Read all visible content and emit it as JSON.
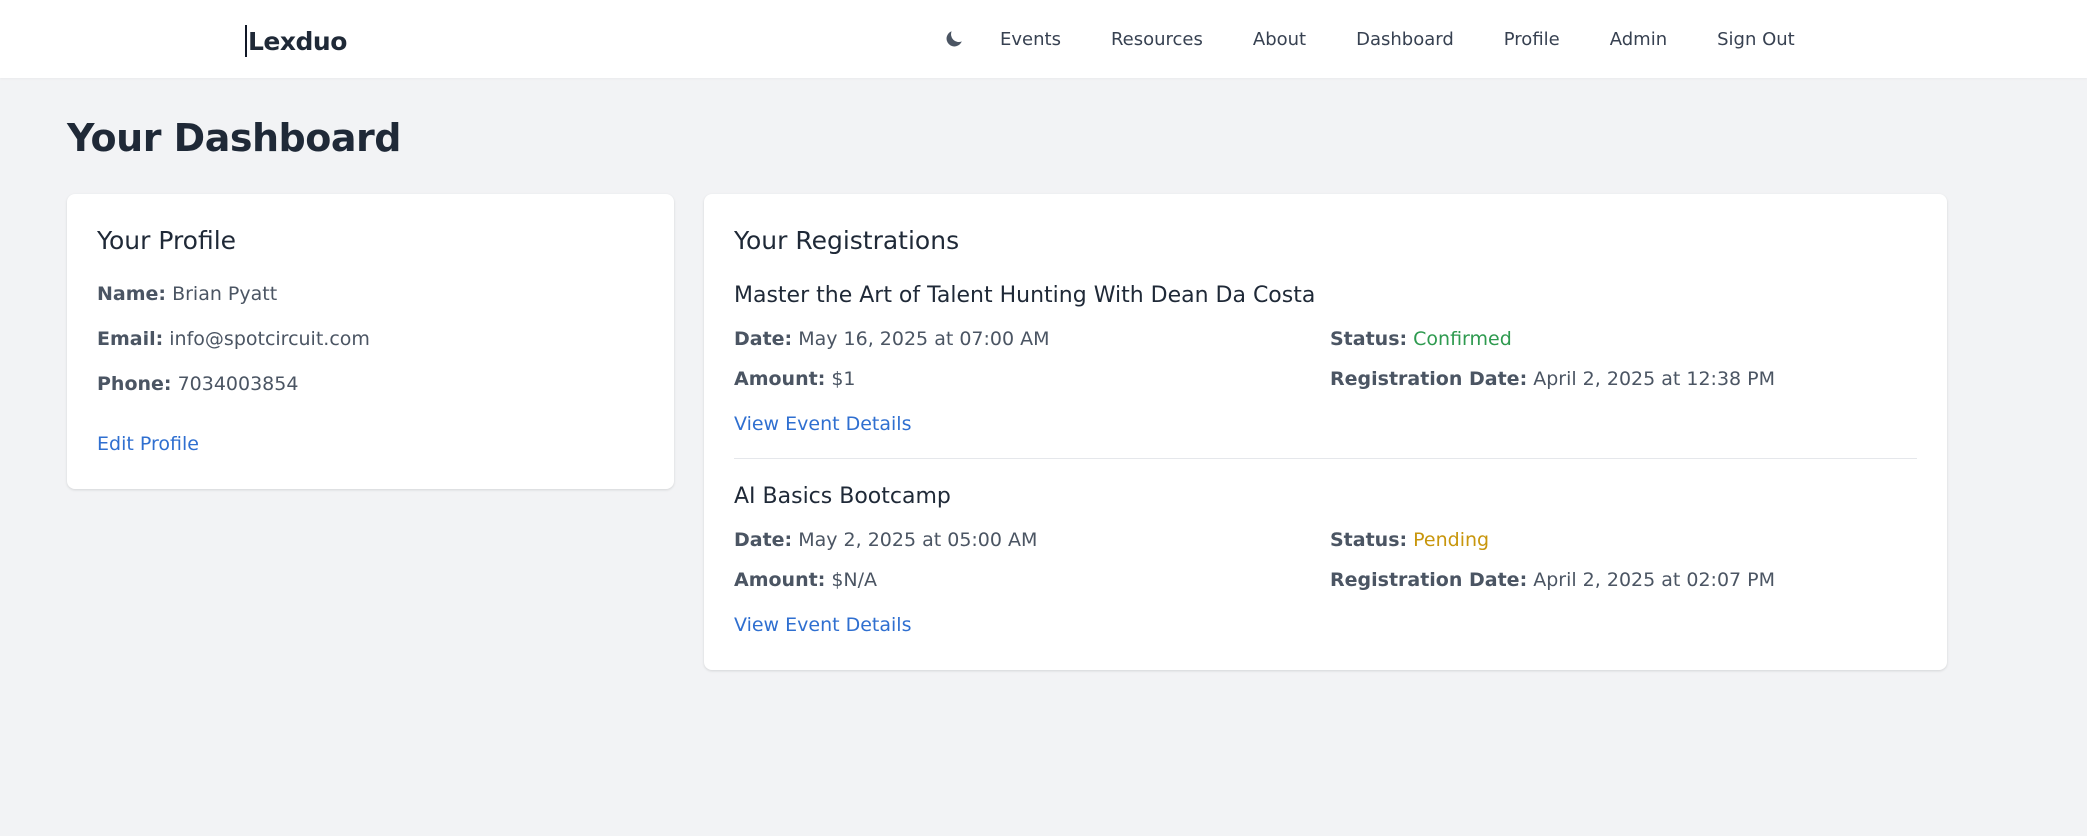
{
  "brand": {
    "name": "Lexduo"
  },
  "nav": {
    "theme_icon": "moon-icon",
    "items": [
      "Events",
      "Resources",
      "About",
      "Dashboard",
      "Profile",
      "Admin",
      "Sign Out"
    ]
  },
  "page": {
    "title": "Your Dashboard"
  },
  "profile": {
    "title": "Your Profile",
    "name_label": "Name:",
    "name": "Brian Pyatt",
    "email_label": "Email:",
    "email": "info@spotcircuit.com",
    "phone_label": "Phone:",
    "phone": "7034003854",
    "edit_label": "Edit Profile"
  },
  "registrations": {
    "title": "Your Registrations",
    "items": [
      {
        "event_title": "Master the Art of Talent Hunting With Dean Da Costa",
        "date_label": "Date:",
        "date": "May 16, 2025 at 07:00 AM",
        "amount_label": "Amount:",
        "amount": "$1",
        "status_label": "Status:",
        "status": "Confirmed",
        "registration_date_label": "Registration Date:",
        "registration_date": "April 2, 2025 at 12:38 PM",
        "details_label": "View Event Details"
      },
      {
        "event_title": "AI Basics Bootcamp",
        "date_label": "Date:",
        "date": "May 2, 2025 at 05:00 AM",
        "amount_label": "Amount:",
        "amount": "$N/A",
        "status_label": "Status:",
        "status": "Pending",
        "registration_date_label": "Registration Date:",
        "registration_date": "April 2, 2025 at 02:07 PM",
        "details_label": "View Event Details"
      }
    ]
  },
  "colors": {
    "background": "#f2f3f5",
    "link": "#2f6fd0",
    "status_confirmed": "#2e9a4f",
    "status_pending": "#c8960c"
  }
}
